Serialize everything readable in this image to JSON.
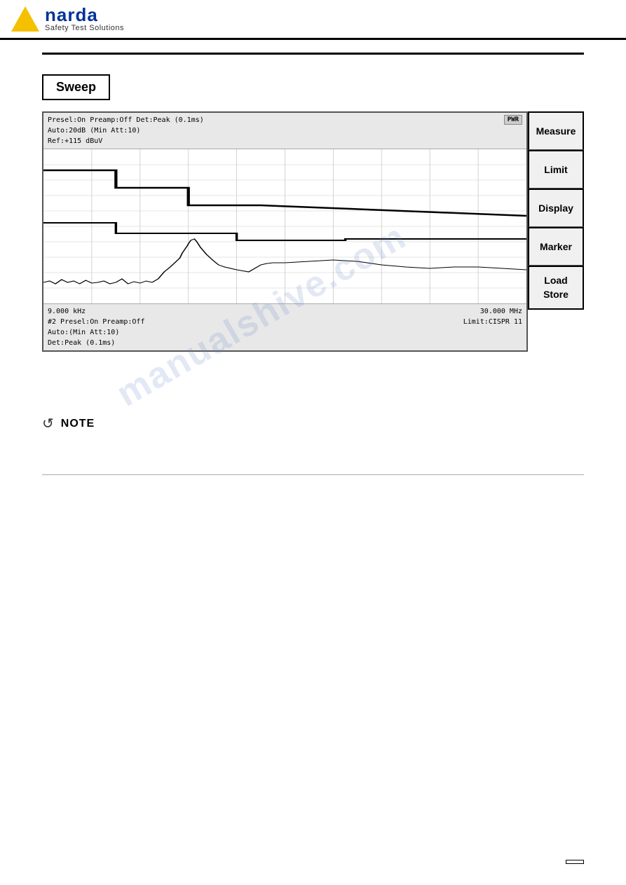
{
  "header": {
    "logo_narda": "narda",
    "logo_subtitle": "Safety Test Solutions"
  },
  "sweep_button": {
    "label": "Sweep"
  },
  "screen": {
    "info_line1": "Presel:On  Preamp:Off  Det:Peak  (0.1ms)",
    "info_line2": "Auto:20dB (Min Att:10)",
    "info_line3": "Ref:+115 dBuV",
    "pwr": "PWR",
    "bottom_left_line1": "9.000 kHz",
    "bottom_left_line2": "#2 Presel:On   Preamp:Off",
    "bottom_left_line3": "Auto:(Min Att:10)",
    "bottom_left_line4": "Det:Peak  (0.1ms)",
    "bottom_right_line1": "30.000 MHz",
    "bottom_right_line2": "Limit:CISPR 11"
  },
  "side_buttons": [
    {
      "label": "Measure",
      "id": "measure"
    },
    {
      "label": "Limit",
      "id": "limit"
    },
    {
      "label": "Display",
      "id": "display"
    },
    {
      "label": "Marker",
      "id": "marker"
    },
    {
      "label": "Load\nStore",
      "id": "load-store"
    }
  ],
  "watermark": {
    "text": "manualshive.com"
  },
  "note": {
    "icon": "⟳",
    "label": "NOTE"
  },
  "footer": {
    "page": ""
  }
}
